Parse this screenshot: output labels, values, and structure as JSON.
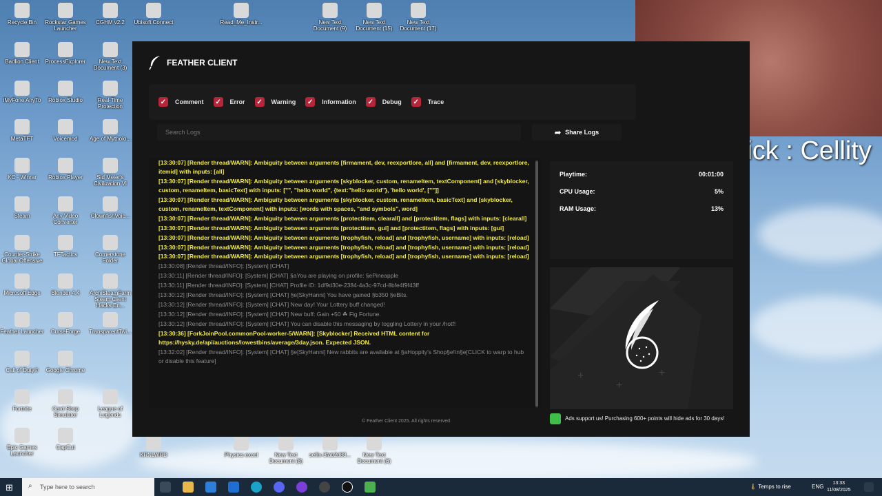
{
  "desktop": {
    "icons": [
      {
        "label": "Recycle Bin"
      },
      {
        "label": "Rockstar Games Launcher"
      },
      {
        "label": "CGHM v2.2"
      },
      {
        "label": "Ubisoft Connect"
      },
      {
        "label": "Read_Me_Instr..."
      },
      {
        "label": "New Text Document (9)"
      },
      {
        "label": "New Text Document (15)"
      },
      {
        "label": "New Text Document (17)"
      },
      {
        "label": "Badlion Client"
      },
      {
        "label": "ProcessExplorer"
      },
      {
        "label": "New Text Document (3)"
      },
      {
        "label": "iMyFone AnyTo"
      },
      {
        "label": "Roblox Studio"
      },
      {
        "label": "Real-Time Protection"
      },
      {
        "label": "MetaTFT"
      },
      {
        "label": "Voicemod"
      },
      {
        "label": "Age of Mytholo..."
      },
      {
        "label": "KC - Winrar"
      },
      {
        "label": "Roblox Player"
      },
      {
        "label": "Sid Meier's Civilization VI"
      },
      {
        "label": "Steam"
      },
      {
        "label": "Any Video Converter"
      },
      {
        "label": "ClownfishVoic..."
      },
      {
        "label": "Counter-Strike Global Offensive"
      },
      {
        "label": "TFTactics"
      },
      {
        "label": "Cornerstone Folder"
      },
      {
        "label": "Microsoft Edge"
      },
      {
        "label": "Blender 4.4"
      },
      {
        "label": "ArchiSteamFarm Steam Client Hacks En..."
      },
      {
        "label": "Feather Launcher"
      },
      {
        "label": "CurseForge"
      },
      {
        "label": "TransparentTwi..."
      },
      {
        "label": "Call of Duty®"
      },
      {
        "label": "Google Chrome"
      },
      {
        "label": "Fortnite"
      },
      {
        "label": "Card Shop Simulator"
      },
      {
        "label": "League of Legends"
      },
      {
        "label": "Epic Games Launcher"
      },
      {
        "label": "CapCut"
      },
      {
        "label": "KRNLWRD"
      },
      {
        "label": "Physics excel"
      },
      {
        "label": "New Text Document (8)"
      },
      {
        "label": "sellix-3fab2d83..."
      },
      {
        "label": "New Text Document (6)"
      }
    ]
  },
  "overlay": {
    "kick_text": "Kick : Cellity"
  },
  "app": {
    "title": "FEATHER CLIENT",
    "filters": [
      {
        "label": "Comment",
        "checked": true
      },
      {
        "label": "Error",
        "checked": true
      },
      {
        "label": "Warning",
        "checked": true
      },
      {
        "label": "Information",
        "checked": true
      },
      {
        "label": "Debug",
        "checked": true
      },
      {
        "label": "Trace",
        "checked": true
      }
    ],
    "search_placeholder": "Search Logs",
    "share_label": "Share Logs",
    "logs": [
      {
        "level": "warn",
        "text": "[13:30:07] [Render thread/WARN]: Ambiguity between arguments [firmament, dev, reexportlore, all] and [firmament, dev, reexportlore, itemid] with inputs: [all]"
      },
      {
        "level": "warn",
        "text": "[13:30:07] [Render thread/WARN]: Ambiguity between arguments [skyblocker, custom, renameItem, textComponent] and [skyblocker, custom, renameItem, basicText] with inputs: [\"\", \"hello world\", {text:\"hello world\"}, 'hello world', [\"\"]]"
      },
      {
        "level": "warn",
        "text": "[13:30:07] [Render thread/WARN]: Ambiguity between arguments [skyblocker, custom, renameItem, basicText] and [skyblocker, custom, renameItem, textComponent] with inputs: [words with spaces, \"and symbols\", word]"
      },
      {
        "level": "warn",
        "text": "[13:30:07] [Render thread/WARN]: Ambiguity between arguments [protectitem, clearall] and [protectitem, flags] with inputs: [clearall]"
      },
      {
        "level": "warn",
        "text": "[13:30:07] [Render thread/WARN]: Ambiguity between arguments [protectitem, gui] and [protectitem, flags] with inputs: [gui]"
      },
      {
        "level": "warn",
        "text": "[13:30:07] [Render thread/WARN]: Ambiguity between arguments [trophyfish, reload] and [trophyfish, username] with inputs: [reload]"
      },
      {
        "level": "warn",
        "text": "[13:30:07] [Render thread/WARN]: Ambiguity between arguments [trophyfish, reload] and [trophyfish, username] with inputs: [reload] [13:30:07] [Render thread/WARN]: Ambiguity between arguments [trophyfish, reload] and [trophyfish, username] with inputs: [reload]"
      },
      {
        "level": "info",
        "text": "[13:30:08] [Render thread/INFO]: [System] [CHAT]"
      },
      {
        "level": "info",
        "text": "[13:30:11] [Render thread/INFO]: [System] [CHAT] §aYou are playing on profile: §ePineapple"
      },
      {
        "level": "info",
        "text": "[13:30:11] [Render thread/INFO]: [System] [CHAT] Profile ID: 1df9d30e-2384-4a3c-97cd-8bfe4f9f43ff"
      },
      {
        "level": "info",
        "text": "[13:30:12] [Render thread/INFO]: [System] [CHAT] §e[SkyHanni] You have gained §b350 §eBits."
      },
      {
        "level": "info",
        "text": "[13:30:12] [Render thread/INFO]: [System] [CHAT] New day! Your Lottery buff changed!"
      },
      {
        "level": "info",
        "text": "[13:30:12] [Render thread/INFO]: [System] [CHAT] New buff: Gain +50 ☘ Fig Fortune."
      },
      {
        "level": "info",
        "text": "[13:30:12] [Render thread/INFO]: [System] [CHAT] You can disable this messaging by toggling Lottery in your /hotf!"
      },
      {
        "level": "warn",
        "text": "[13:30:36] [ForkJoinPool.commonPool-worker-5/WARN]: [Skyblocker] Received HTML content for https://hysky.de/api/auctions/lowestbins/average/3day.json. Expected JSON."
      },
      {
        "level": "info",
        "text": "[13:32:02] [Render thread/INFO]: [System] [CHAT] §e[SkyHanni] New rabbits are available at §aHoppity's Shop§e!\\n§e[CLICK to warp to hub or disable this feature]"
      }
    ],
    "stats": [
      {
        "label": "Playtime:",
        "value": "00:01:00"
      },
      {
        "label": "CPU Usage:",
        "value": "5%"
      },
      {
        "label": "RAM Usage:",
        "value": "13%"
      }
    ],
    "footer": "© Feather Client 2025. All rights reserved.",
    "ad_note": "Ads support us! Purchasing 600+ points will hide ads for 30 days!"
  },
  "taskbar": {
    "search_placeholder": "Type here to search",
    "weather": "Temps to rise",
    "language": "ENG",
    "time": "13:33",
    "date": "11/08/2025"
  }
}
